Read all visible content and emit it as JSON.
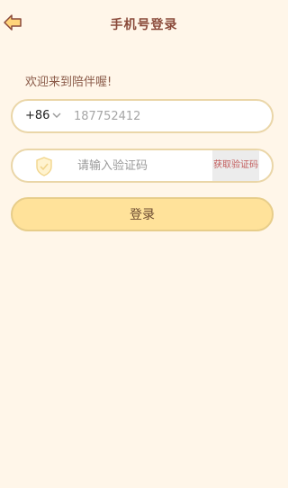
{
  "header": {
    "title": "手机号登录",
    "back_icon": "arrow-left-icon"
  },
  "welcome_text": "欢迎来到陪伴喔!",
  "phone": {
    "country_code": "+86",
    "value": "",
    "placeholder": "187752412"
  },
  "verification": {
    "icon": "shield-icon",
    "value": "",
    "placeholder": "请输入验证码",
    "get_code_label": "获取验证码"
  },
  "login_label": "登录",
  "colors": {
    "background": "#fff6e9",
    "title": "#8a4a3a",
    "field_border": "#ead6a8",
    "login_fill": "#ffe29a",
    "get_code_text": "#c25a5a"
  }
}
